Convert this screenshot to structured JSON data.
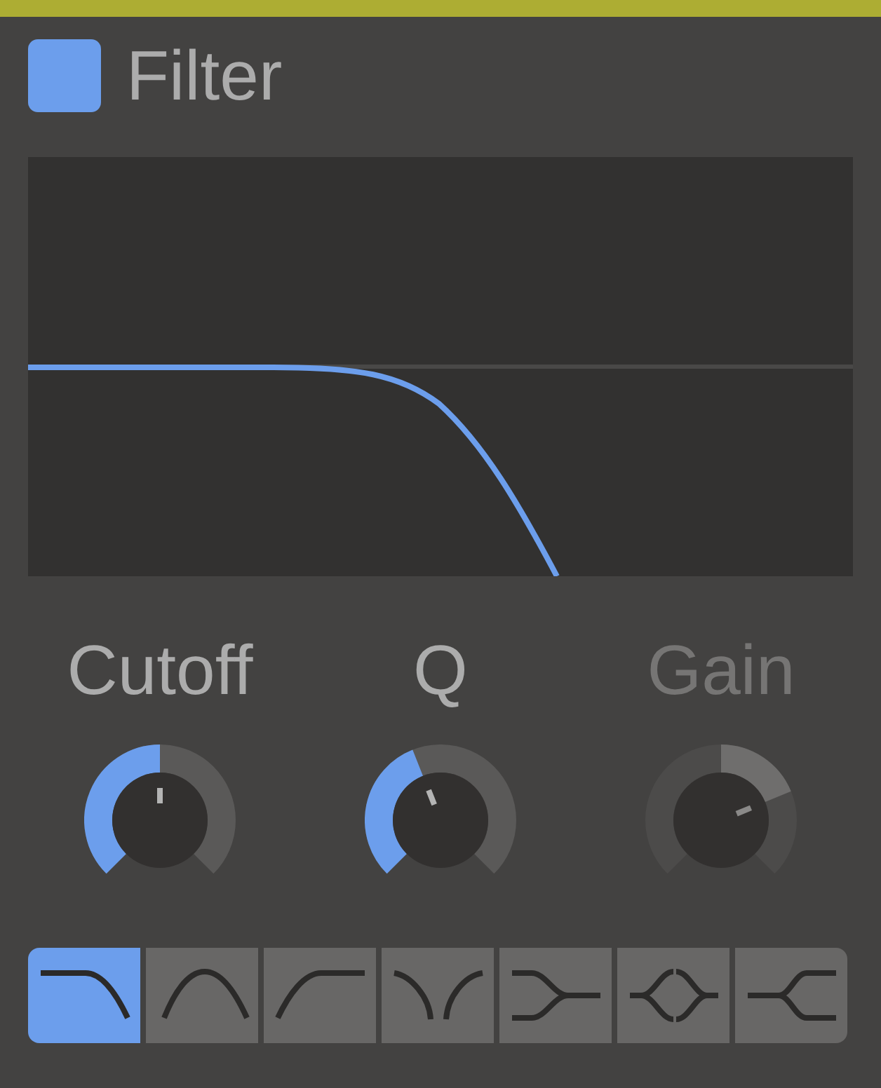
{
  "header": {
    "enabled": true,
    "title": "Filter"
  },
  "knobs": [
    {
      "label": "Cutoff",
      "kind": "unipolar",
      "level": 0.5,
      "disabled": false
    },
    {
      "label": "Q",
      "kind": "unipolar",
      "level": 0.42,
      "disabled": false
    },
    {
      "label": "Gain",
      "kind": "bipolar",
      "level": 0.75,
      "disabled": true
    }
  ],
  "filter_types": [
    {
      "kind": "lowpass",
      "selected": true
    },
    {
      "kind": "bandpass",
      "selected": false
    },
    {
      "kind": "highpass",
      "selected": false
    },
    {
      "kind": "notch",
      "selected": false
    },
    {
      "kind": "lowshelf",
      "selected": false
    },
    {
      "kind": "peak",
      "selected": false
    },
    {
      "kind": "highshelf",
      "selected": false
    }
  ]
}
